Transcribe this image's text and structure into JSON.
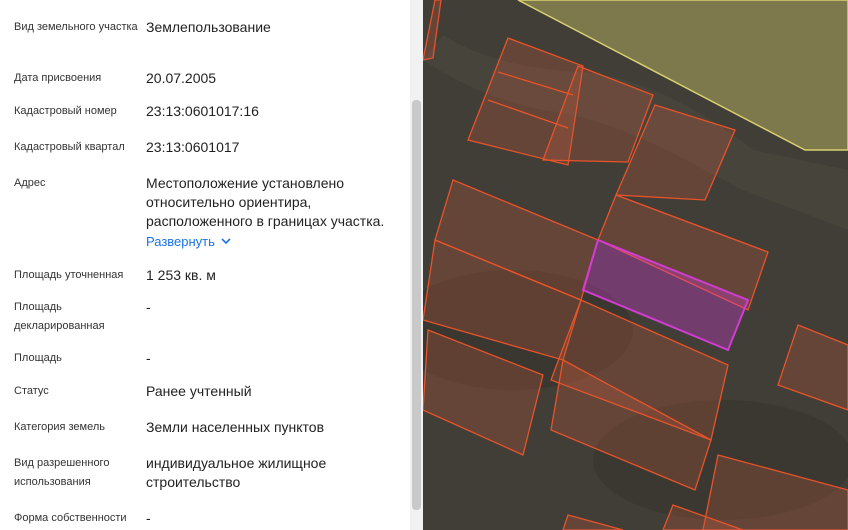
{
  "panel": {
    "fields": [
      {
        "label": "Вид земельного участка",
        "value": "Землепользование"
      },
      {
        "label": "Дата присвоения",
        "value": "20.07.2005"
      },
      {
        "label": "Кадастровый номер",
        "value": "23:13:0601017:16"
      },
      {
        "label": "Кадастровый квартал",
        "value": "23:13:0601017"
      },
      {
        "label": "Адрес",
        "value": "Местоположение установлено относительно ориентира, расположенного в границах участка.",
        "expand_label": "Развернуть"
      },
      {
        "label": "Площадь уточненная",
        "value": "1 253 кв. м"
      },
      {
        "label": "Площадь декларированная",
        "value": "-"
      },
      {
        "label": "Площадь",
        "value": "-"
      },
      {
        "label": "Статус",
        "value": "Ранее учтенный"
      },
      {
        "label": "Категория земель",
        "value": "Земли населенных пунктов"
      },
      {
        "label": "Вид разрешенного использования",
        "value": "индивидуальное жилищное строительство"
      },
      {
        "label": "Форма собственности",
        "value": "-"
      }
    ]
  },
  "icons": {
    "expand": "chevron-down-icon"
  },
  "colors": {
    "link": "#1a73e8",
    "parcel_outline": "#e8532a",
    "selected_parcel": "#d23cd2",
    "field_zone": "#c9c26a"
  }
}
